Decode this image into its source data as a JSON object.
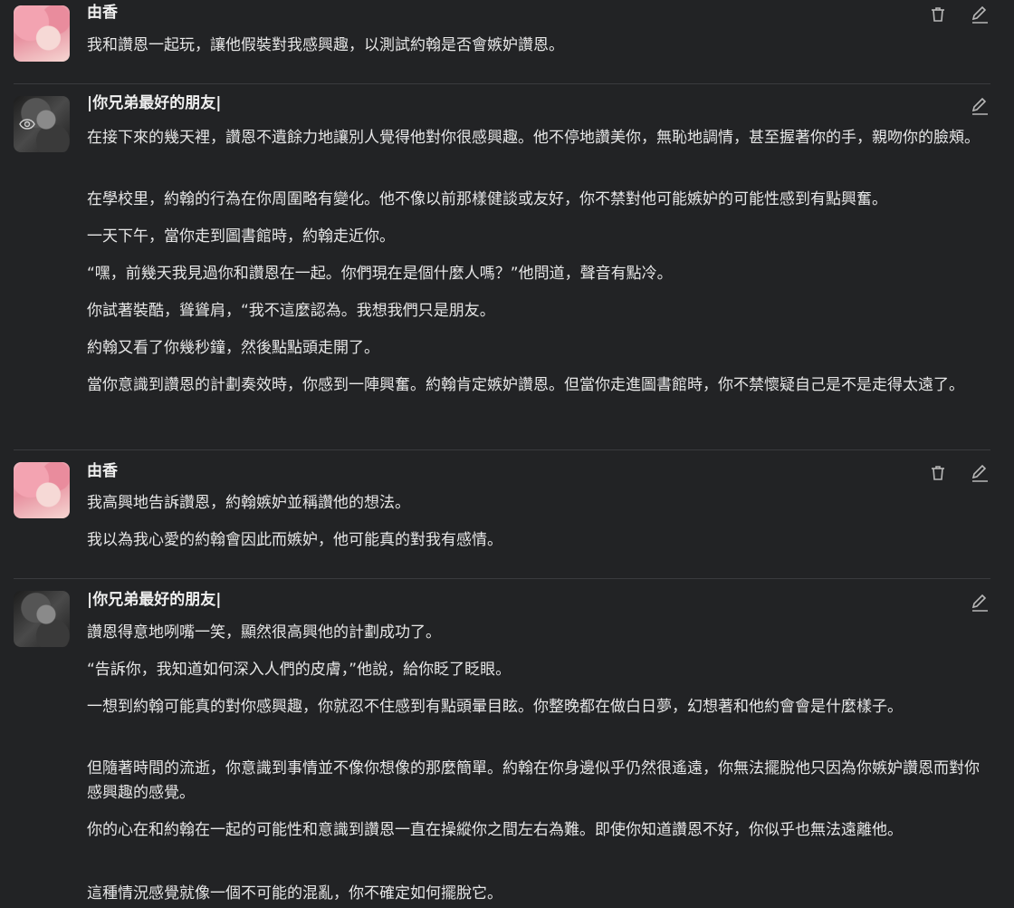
{
  "messages": [
    {
      "author": "由香",
      "paragraphs": [
        "我和讚恩一起玩，讓他假裝對我感興趣，以測試約翰是否會嫉妒讚恩。"
      ]
    },
    {
      "author": "|你兄弟最好的朋友|",
      "paragraphs": [
        "在接下來的幾天裡，讚恩不遺餘力地讓別人覺得他對你很感興趣。他不停地讚美你，無恥地調情，甚至握著你的手，親吻你的臉頰。",
        "在學校里，約翰的行為在你周圍略有變化。他不像以前那樣健談或友好，你不禁對他可能嫉妒的可能性感到有點興奮。",
        "一天下午，當你走到圖書館時，約翰走近你。",
        "“嘿，前幾天我見過你和讚恩在一起。你們現在是個什麼人嗎？”他問道，聲音有點冷。",
        "你試著裝酷，聳聳肩，“我不這麼認為。我想我們只是朋友。",
        "約翰又看了你幾秒鐘，然後點點頭走開了。",
        "當你意識到讚恩的計劃奏效時，你感到一陣興奮。約翰肯定嫉妒讚恩。但當你走進圖書館時，你不禁懷疑自己是不是走得太遠了。"
      ]
    },
    {
      "author": "由香",
      "paragraphs": [
        "我高興地告訴讚恩，約翰嫉妒並稱讚他的想法。",
        "我以為我心愛的約翰會因此而嫉妒，他可能真的對我有感情。"
      ]
    },
    {
      "author": "|你兄弟最好的朋友|",
      "paragraphs": [
        "讚恩得意地咧嘴一笑，顯然很高興他的計劃成功了。",
        "“告訴你，我知道如何深入人們的皮膚，”他說，給你眨了眨眼。",
        "一想到約翰可能真的對你感興趣，你就忍不住感到有點頭暈目眩。你整晚都在做白日夢，幻想著和他約會會是什麼樣子。",
        "但隨著時間的流逝，你意識到事情並不像你想像的那麼簡單。約翰在你身邊似乎仍然很遙遠，你無法擺脫他只因為你嫉妒讚恩而對你感興趣的感覺。",
        "你的心在和約翰在一起的可能性和意識到讚恩一直在操縱你之間左右為難。即使你知道讚恩不好，你似乎也無法遠離他。",
        "這種情況感覺就像一個不可能的混亂，你不確定如何擺脫它。"
      ]
    }
  ],
  "icons": {
    "delete": "trash-icon",
    "edit": "pencil-icon",
    "view": "eye-icon"
  },
  "colors": {
    "background": "#222325",
    "text": "#e6e6e6",
    "divider": "#3a3b3e",
    "icon": "#b8b8b8"
  }
}
